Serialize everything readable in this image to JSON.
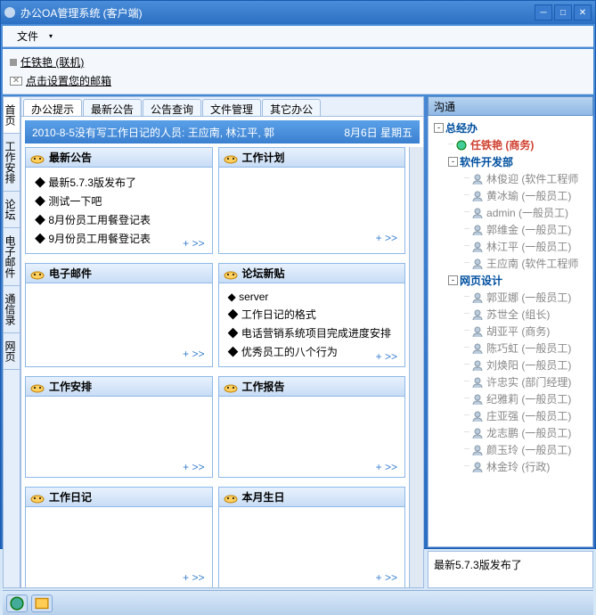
{
  "window": {
    "title": "办公OA管理系统 (客户端)"
  },
  "menu": {
    "file": "文件"
  },
  "user": {
    "name_status": "任铁艳 (联机)",
    "set_email": "点击设置您的邮箱"
  },
  "left_tabs": [
    "首页",
    "工作安排",
    "论坛",
    "电子邮件",
    "通信录",
    "网页"
  ],
  "top_tabs": [
    "办公提示",
    "最新公告",
    "公告查询",
    "文件管理",
    "其它办公"
  ],
  "notice": {
    "msg": "2010-8-5没有写工作日记的人员: 王应南, 林江平, 郭",
    "date": "8月6日  星期五"
  },
  "panels": {
    "p1": {
      "title": "最新公告",
      "items": [
        "最新5.7.3版发布了",
        "测试一下吧",
        "8月份员工用餐登记表",
        "9月份员工用餐登记表"
      ]
    },
    "p2": {
      "title": "工作计划",
      "items": []
    },
    "p3": {
      "title": "电子邮件",
      "items": []
    },
    "p4": {
      "title": "论坛新贴",
      "items": [
        "server",
        "工作日记的格式",
        "电话营销系统项目完成进度安排",
        "优秀员工的八个行为"
      ]
    },
    "p5": {
      "title": "工作安排",
      "items": []
    },
    "p6": {
      "title": "工作报告",
      "items": []
    },
    "p7": {
      "title": "工作日记",
      "items": []
    },
    "p8": {
      "title": "本月生日",
      "items": []
    }
  },
  "more": "+  >>",
  "comm": {
    "header": "沟通"
  },
  "tree": [
    {
      "level": 0,
      "type": "root",
      "toggle": "-",
      "label": "总经办"
    },
    {
      "level": 1,
      "type": "self",
      "label": "任铁艳 (商务)"
    },
    {
      "level": 1,
      "type": "dept",
      "toggle": "-",
      "label": "软件开发部"
    },
    {
      "level": 2,
      "type": "emp",
      "label": "林俊迎 (软件工程师"
    },
    {
      "level": 2,
      "type": "emp",
      "label": "黄冰瑜 (一般员工)"
    },
    {
      "level": 2,
      "type": "emp",
      "label": "admin (一般员工)"
    },
    {
      "level": 2,
      "type": "emp",
      "label": "郭维金 (一般员工)"
    },
    {
      "level": 2,
      "type": "emp",
      "label": "林江平 (一般员工)"
    },
    {
      "level": 2,
      "type": "emp",
      "label": "王应南 (软件工程师"
    },
    {
      "level": 1,
      "type": "dept",
      "toggle": "-",
      "label": "网页设计"
    },
    {
      "level": 2,
      "type": "emp",
      "label": "郭亚娜 (一般员工)"
    },
    {
      "level": 2,
      "type": "emp",
      "label": "苏世全 (组长)"
    },
    {
      "level": 2,
      "type": "emp",
      "label": "胡亚平 (商务)"
    },
    {
      "level": 2,
      "type": "emp",
      "label": "陈巧虹 (一般员工)"
    },
    {
      "level": 2,
      "type": "emp",
      "label": "刘焕阳 (一般员工)"
    },
    {
      "level": 2,
      "type": "emp",
      "label": "许忠实 (部门经理)"
    },
    {
      "level": 2,
      "type": "emp",
      "label": "纪雅莉 (一般员工)"
    },
    {
      "level": 2,
      "type": "emp",
      "label": "庄亚强 (一般员工)"
    },
    {
      "level": 2,
      "type": "emp",
      "label": "龙志鹏 (一般员工)"
    },
    {
      "level": 2,
      "type": "emp",
      "label": "颜玉玲 (一般员工)"
    },
    {
      "level": 2,
      "type": "emp",
      "label": "林金玲 (行政)"
    }
  ],
  "right_footer": "最新5.7.3版发布了"
}
